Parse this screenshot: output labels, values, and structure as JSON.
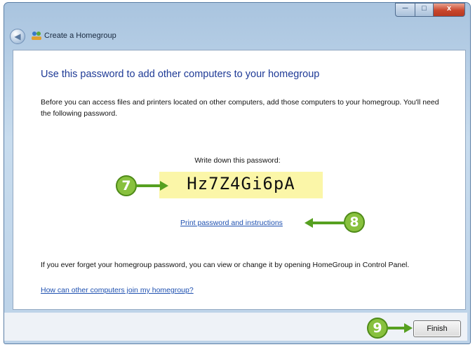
{
  "window": {
    "title": "Create a Homegroup",
    "back_glyph": "◀",
    "min_glyph": "─",
    "max_glyph": "□",
    "close_glyph": "x"
  },
  "content": {
    "heading": "Use this password to add other computers to your homegroup",
    "description": "Before you can access files and printers located on other computers, add those computers to your homegroup. You'll need the following password.",
    "write_down_label": "Write down this password:",
    "password": "Hz7Z4Gi6pA",
    "print_link": "Print password and instructions",
    "forget_text": "If you ever forget your homegroup password, you can view or change it by opening HomeGroup in Control Panel.",
    "help_link": "How can other computers join my homegroup?"
  },
  "footer": {
    "finish_label": "Finish"
  },
  "callouts": {
    "step7": "7",
    "step8": "8",
    "step9": "9",
    "color": "#88c13e"
  }
}
